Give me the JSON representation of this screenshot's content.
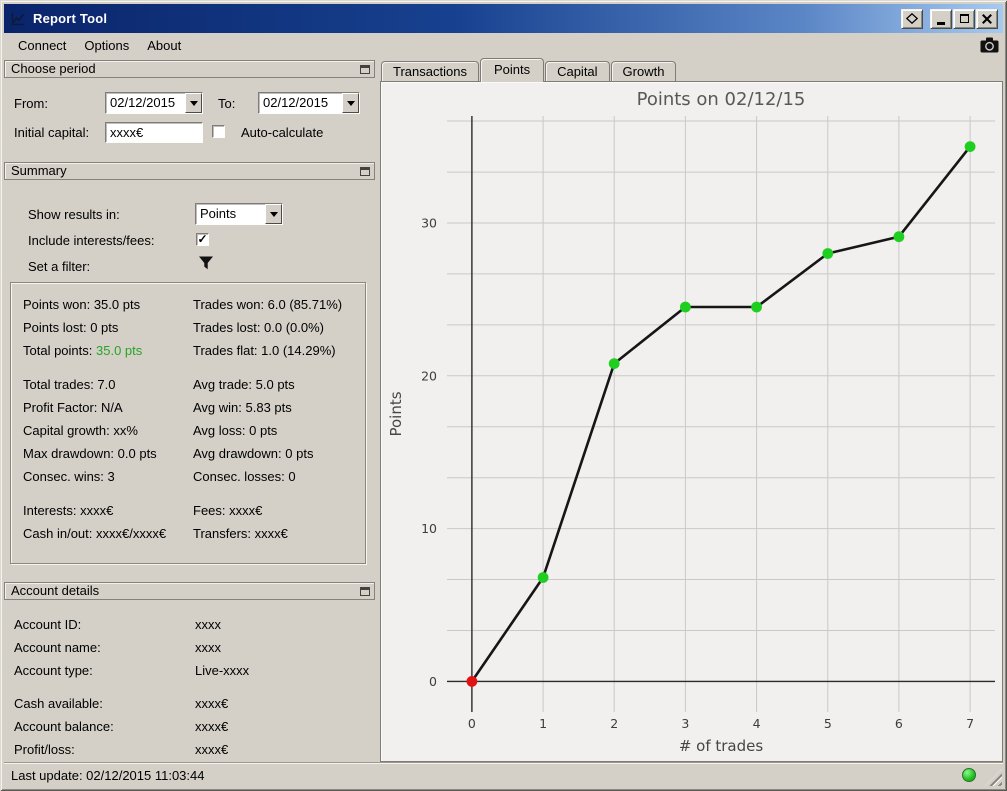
{
  "window": {
    "title": "Report Tool"
  },
  "menu": {
    "items": [
      "Connect",
      "Options",
      "About"
    ]
  },
  "choose_period": {
    "title": "Choose period",
    "from_label": "From:",
    "from_value": "02/12/2015",
    "to_label": "To:",
    "to_value": "02/12/2015",
    "initial_capital_label": "Initial capital:",
    "initial_capital_value": "xxxx€",
    "auto_calculate_label": "Auto-calculate",
    "auto_calculate_checked": false
  },
  "summary": {
    "title": "Summary",
    "show_results_label": "Show results in:",
    "show_results_value": "Points",
    "include_interests_label": "Include interests/fees:",
    "include_interests_checked": true,
    "checkmark": "✓",
    "set_filter_label": "Set a filter:",
    "stats": {
      "points_won": "Points won: 35.0 pts",
      "trades_won": "Trades won: 6.0 (85.71%)",
      "points_lost": "Points lost: 0 pts",
      "trades_lost": "Trades lost: 0.0 (0.0%)",
      "total_points_label": "Total points:",
      "total_points_value": "35.0 pts",
      "total_points_color": "#28a428",
      "trades_flat": "Trades flat: 1.0 (14.29%)",
      "total_trades": "Total trades: 7.0",
      "avg_trade": "Avg trade: 5.0 pts",
      "profit_factor": "Profit Factor: N/A",
      "avg_win": "Avg win: 5.83 pts",
      "capital_growth": "Capital growth: xx%",
      "avg_loss": "Avg loss: 0 pts",
      "max_drawdown": "Max drawdown: 0.0 pts",
      "avg_drawdown": "Avg drawdown: 0 pts",
      "consec_wins": "Consec. wins: 3",
      "consec_losses": "Consec. losses: 0",
      "interests": "Interests: xxxx€",
      "fees": "Fees: xxxx€",
      "cash_in_out": "Cash in/out: xxxx€/xxxx€",
      "transfers": "Transfers: xxxx€"
    }
  },
  "account_details": {
    "title": "Account details",
    "rows": [
      {
        "label": "Account ID:",
        "value": "xxxx"
      },
      {
        "label": "Account name:",
        "value": "xxxx"
      },
      {
        "label": "Account type:",
        "value": "Live-xxxx"
      },
      {
        "label": "Cash available:",
        "value": "xxxx€"
      },
      {
        "label": "Account balance:",
        "value": "xxxx€"
      },
      {
        "label": "Profit/loss:",
        "value": "xxxx€"
      }
    ]
  },
  "status_bar": {
    "last_update": "Last update: 02/12/2015 11:03:44"
  },
  "tabs": [
    {
      "label": "Transactions",
      "active": false
    },
    {
      "label": "Points",
      "active": true
    },
    {
      "label": "Capital",
      "active": false
    },
    {
      "label": "Growth",
      "active": false
    }
  ],
  "chart_data": {
    "type": "line",
    "title": "Points on 02/12/15",
    "xlabel": "# of trades",
    "ylabel": "Points",
    "x": [
      0,
      1,
      2,
      3,
      4,
      5,
      6,
      7
    ],
    "y": [
      0,
      6.8,
      20.8,
      24.5,
      24.5,
      28.0,
      29.1,
      35.0
    ],
    "xlim": [
      -0.35,
      7.35
    ],
    "ylim": [
      -2,
      37
    ],
    "xticks": [
      0,
      1,
      2,
      3,
      4,
      5,
      6,
      7
    ],
    "yticks": [
      0,
      10,
      20,
      30
    ],
    "xgrid": [
      0,
      1,
      2,
      3,
      4,
      5,
      6,
      7
    ],
    "ygrid": [
      0,
      3.33,
      6.67,
      10,
      13.33,
      16.67,
      20,
      23.33,
      26.67,
      30,
      33.33,
      36.67
    ],
    "grid": true,
    "legend": "none",
    "grid_color": "#c9c9c9",
    "line_color": "#161616",
    "marker_color": "#1fcf1f",
    "first_marker_color": "#e31212"
  },
  "icons": {
    "app_icon": "line-chart",
    "detach_icon": "diamond",
    "minimize_icon": "underscore",
    "maximize_icon": "square",
    "close_icon": "✕",
    "camera_icon": "camera",
    "float_panel_icon": "mini-window",
    "filter_icon": "funnel",
    "dropdown_arrow_icon": "▼",
    "checkmark_icon": "✓",
    "status_led": "green-circle",
    "resize_grip": "diagonal-lines"
  }
}
